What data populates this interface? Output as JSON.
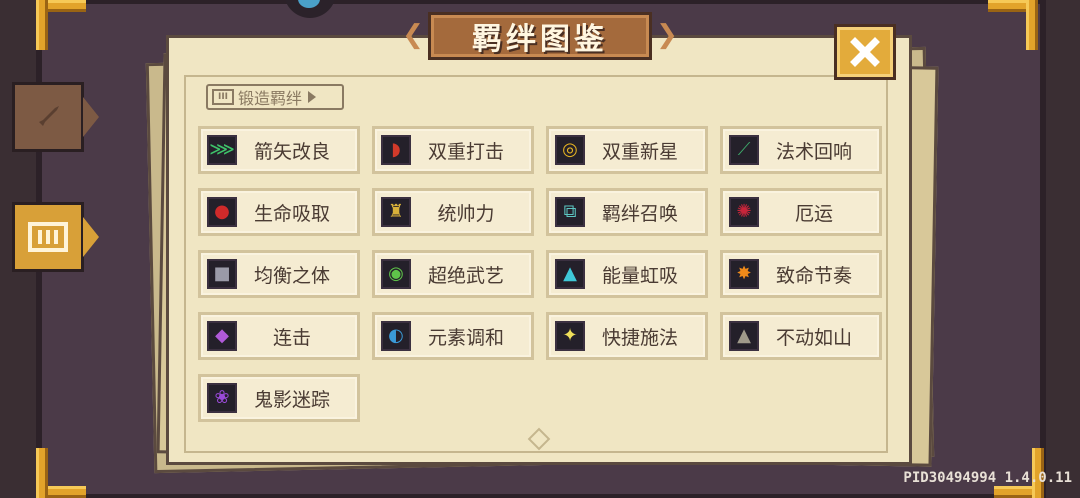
{
  "title": "羁绊图鉴",
  "forge_label": "锻造羁绊",
  "close_symbol": "✕",
  "build_info": "PID30494994 1.4.0.11",
  "side_tabs": [
    {
      "name": "weapon",
      "icon": "sword-icon",
      "selected": false
    },
    {
      "name": "bond",
      "icon": "bond-icon",
      "selected": true
    }
  ],
  "bonds": [
    {
      "label": "箭矢改良",
      "icon": "arrows-icon",
      "color": "#3ec46a",
      "glyph": "⋙"
    },
    {
      "label": "双重打击",
      "icon": "red-bow-icon",
      "color": "#d23a2a",
      "glyph": "◗"
    },
    {
      "label": "双重新星",
      "icon": "golden-ring-icon",
      "color": "#e6b422",
      "glyph": "◎"
    },
    {
      "label": "法术回响",
      "icon": "staff-icon",
      "color": "#3ea86a",
      "glyph": "⟋"
    },
    {
      "label": "生命吸取",
      "icon": "red-skull-icon",
      "color": "#d02a2a",
      "glyph": "●"
    },
    {
      "label": "统帅力",
      "icon": "golden-trophy-icon",
      "color": "#d9b13a",
      "glyph": "♜"
    },
    {
      "label": "羁绊召唤",
      "icon": "summon-card-icon",
      "color": "#5cc7c2",
      "glyph": "⧉"
    },
    {
      "label": "厄运",
      "icon": "red-swirl-icon",
      "color": "#c8253a",
      "glyph": "✺"
    },
    {
      "label": "均衡之体",
      "icon": "grey-armor-icon",
      "color": "#9a9aa8",
      "glyph": "■"
    },
    {
      "label": "超绝武艺",
      "icon": "green-shield-icon",
      "color": "#5fc44a",
      "glyph": "◉"
    },
    {
      "label": "能量虹吸",
      "icon": "cyan-potion-icon",
      "color": "#3fc8d8",
      "glyph": "▲"
    },
    {
      "label": "致命节奏",
      "icon": "explosion-icon",
      "color": "#f08a1a",
      "glyph": "✸"
    },
    {
      "label": "连击",
      "icon": "purple-crystal-icon",
      "color": "#b05ad8",
      "glyph": "◆"
    },
    {
      "label": "元素调和",
      "icon": "element-orbs-icon",
      "color": "#3a9ad8",
      "glyph": "◐"
    },
    {
      "label": "快捷施法",
      "icon": "lightbulb-icon",
      "color": "#f0e05a",
      "glyph": "✦"
    },
    {
      "label": "不动如山",
      "icon": "mountain-rock-icon",
      "color": "#a09a8a",
      "glyph": "▲"
    },
    {
      "label": "鬼影迷踪",
      "icon": "ghost-icon",
      "color": "#9a4ad8",
      "glyph": "❀"
    }
  ]
}
